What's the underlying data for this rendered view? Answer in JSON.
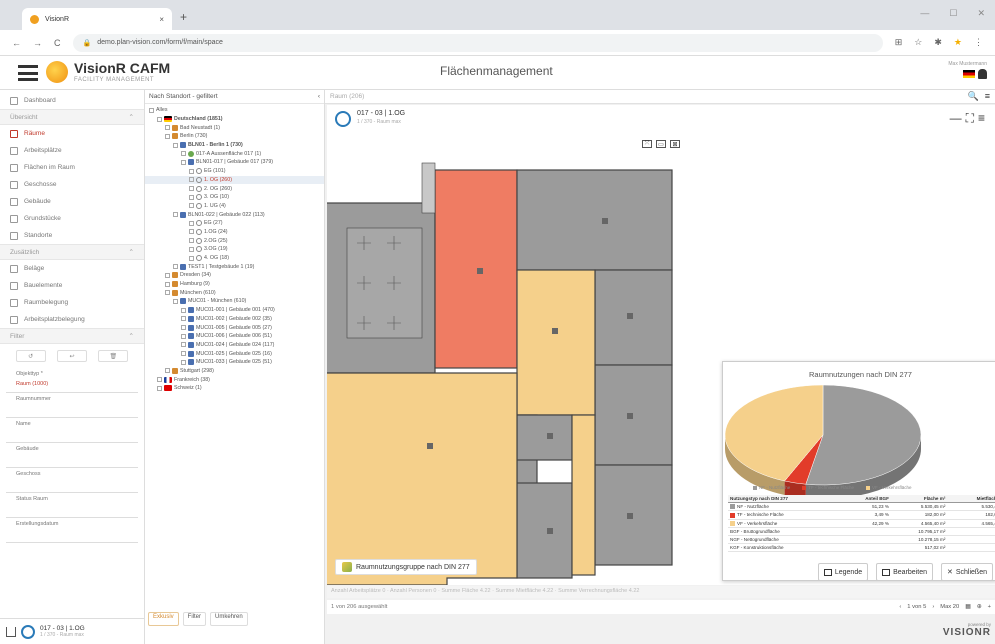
{
  "browser": {
    "tab_title": "VisionR",
    "url": "demo.plan-vision.com/form/f/main/space"
  },
  "header": {
    "brand": "VisionR CAFM",
    "brand_sub": "FACILITY MANAGEMENT",
    "page_title": "Flächenmanagement",
    "user_label": "Max Mustermann"
  },
  "sidebar": {
    "dashboard": "Dashboard",
    "section_overview": "Übersicht",
    "overview_items": [
      {
        "label": "Räume",
        "icon": "door-icon",
        "active": true
      },
      {
        "label": "Arbeitsplätze",
        "icon": "desk-icon",
        "active": false
      },
      {
        "label": "Flächen im Raum",
        "icon": "area-icon",
        "active": false
      },
      {
        "label": "Geschosse",
        "icon": "floor-icon",
        "active": false
      },
      {
        "label": "Gebäude",
        "icon": "building-icon",
        "active": false
      },
      {
        "label": "Grundstücke",
        "icon": "plot-icon",
        "active": false
      },
      {
        "label": "Standorte",
        "icon": "location-icon",
        "active": false
      }
    ],
    "section_additional": "Zusätzlich",
    "additional_items": [
      {
        "label": "Beläge",
        "icon": "flooring-icon"
      },
      {
        "label": "Bauelemente",
        "icon": "element-icon"
      },
      {
        "label": "Raumbelegung",
        "icon": "occupancy-icon"
      },
      {
        "label": "Arbeitsplatzbelegung",
        "icon": "workplace-occupancy-icon"
      }
    ],
    "section_filter": "Filter",
    "filter_fields": [
      {
        "label": "Objekttyp *",
        "value": "Raum (1000)"
      },
      {
        "label": "Raumnummer",
        "value": ""
      },
      {
        "label": "Name",
        "value": ""
      },
      {
        "label": "Gebäude",
        "value": ""
      },
      {
        "label": "Geschoss",
        "value": ""
      },
      {
        "label": "Status Raum",
        "value": ""
      },
      {
        "label": "Erstellungsdatum",
        "value": ""
      }
    ],
    "current_floor": "017 - 03 | 1.OG",
    "current_floor_sub": "1 / 370 - Raum max"
  },
  "tree": {
    "header": "Nach Standort - gefiltert",
    "rows": [
      {
        "level": 0,
        "icon": "",
        "label": "Alles",
        "sel": false
      },
      {
        "level": 1,
        "icon": "de",
        "label": "Deutschland (1851)",
        "sel": false,
        "bold": true
      },
      {
        "level": 2,
        "icon": "city",
        "label": "Bad Neustadt (1)",
        "sel": false
      },
      {
        "level": 2,
        "icon": "city",
        "label": "Berlin (730)",
        "sel": false
      },
      {
        "level": 3,
        "icon": "bld",
        "label": "BLN01 - Berlin 1 (730)",
        "sel": false,
        "bold": true
      },
      {
        "level": 4,
        "icon": "pin",
        "label": "017-A Aussenfläche 017 (1)",
        "sel": false
      },
      {
        "level": 4,
        "icon": "bld",
        "label": "BLN01-017 | Gebäude 017 (379)",
        "sel": false
      },
      {
        "level": 5,
        "icon": "flr",
        "label": "EG (101)",
        "sel": false
      },
      {
        "level": 5,
        "icon": "flr",
        "label": "1. OG (260)",
        "sel": true
      },
      {
        "level": 5,
        "icon": "flr",
        "label": "2. OG (260)",
        "sel": false
      },
      {
        "level": 5,
        "icon": "flr",
        "label": "3. OG (10)",
        "sel": false
      },
      {
        "level": 5,
        "icon": "flr",
        "label": "1. UG (4)",
        "sel": false
      },
      {
        "level": 3,
        "icon": "bld",
        "label": "BLN01-022 | Gebäude 022 (113)",
        "sel": false
      },
      {
        "level": 5,
        "icon": "flr",
        "label": "EG (27)",
        "sel": false
      },
      {
        "level": 5,
        "icon": "flr",
        "label": "1.OG (24)",
        "sel": false
      },
      {
        "level": 5,
        "icon": "flr",
        "label": "2.OG (25)",
        "sel": false
      },
      {
        "level": 5,
        "icon": "flr",
        "label": "3.OG (19)",
        "sel": false
      },
      {
        "level": 5,
        "icon": "flr",
        "label": "4. OG (18)",
        "sel": false
      },
      {
        "level": 3,
        "icon": "bld",
        "label": "TEST1 | Testgebäude 1 (19)",
        "sel": false
      },
      {
        "level": 2,
        "icon": "city",
        "label": "Dresden (34)",
        "sel": false
      },
      {
        "level": 2,
        "icon": "city",
        "label": "Hamburg (9)",
        "sel": false
      },
      {
        "level": 2,
        "icon": "city",
        "label": "München (610)",
        "sel": false
      },
      {
        "level": 3,
        "icon": "bld",
        "label": "MUC01 - München (610)",
        "sel": false
      },
      {
        "level": 4,
        "icon": "bld",
        "label": "MUC01-001 | Gebäude 001 (470)",
        "sel": false
      },
      {
        "level": 4,
        "icon": "bld",
        "label": "MUC01-002 | Gebäude 002 (35)",
        "sel": false
      },
      {
        "level": 4,
        "icon": "bld",
        "label": "MUC01-005 | Gebäude 005 (27)",
        "sel": false
      },
      {
        "level": 4,
        "icon": "bld",
        "label": "MUC01-006 | Gebäude 006 (51)",
        "sel": false
      },
      {
        "level": 4,
        "icon": "bld",
        "label": "MUC01-024 | Gebäude 024 (117)",
        "sel": false
      },
      {
        "level": 4,
        "icon": "bld",
        "label": "MUC01-025 | Gebäude 025 (16)",
        "sel": false
      },
      {
        "level": 4,
        "icon": "bld",
        "label": "MUC01-033 | Gebäude 025 (51)",
        "sel": false
      },
      {
        "level": 2,
        "icon": "city",
        "label": "Stuttgart (298)",
        "sel": false
      },
      {
        "level": 1,
        "icon": "fr",
        "label": "Frankreich (38)",
        "sel": false
      },
      {
        "level": 1,
        "icon": "ch",
        "label": "Schweiz (1)",
        "sel": false
      }
    ],
    "foot_buttons": [
      "Exkusiv",
      "Filter",
      "Umkehren"
    ]
  },
  "main": {
    "search_label": "Raum (206)",
    "floor_title": "017 - 03 | 1.OG",
    "floor_sub": "1 / 370 - Raum max",
    "legend_chip": "Raumnutzungsgruppe nach DIN 277",
    "buttons": [
      "Legende",
      "Bearbeiten",
      "Schließen"
    ],
    "status_text": "Anzahl Arbeitsplätze 0 · Anzahl Personen 0 · Summe Fläche 4.22 · Summe Mietfläche 4.22 · Summe Verrechnungsfläche 4.22",
    "pager_left": "1 von 206 ausgewählt",
    "pager_right": "1 von 5",
    "pager_perpage": "Max 20",
    "footer_powered": "powered by",
    "footer_logo": "VISIONR"
  },
  "chart_data": {
    "type": "pie",
    "title": "Raumnutzungen nach DIN 277",
    "series": [
      {
        "name": "NF - Nutzfläche",
        "value": 51.23,
        "color": "#9b9b9b"
      },
      {
        "name": "TF - technische Fläche",
        "value": 3.49,
        "color": "#e23c2a"
      },
      {
        "name": "VF - Verkehrsfläche",
        "value": 42.29,
        "color": "#f5d08b"
      }
    ],
    "legend_labels": [
      "NF - Nutzfläche",
      "TF - technische Fläche",
      "VF - Verkehrsfläche"
    ],
    "table": {
      "headers": [
        "Nutzungstyp nach DIN 277",
        "Anteil BGF",
        "Fläche m²",
        "Mietfläche m²"
      ],
      "rows": [
        {
          "swatch": "#9b9b9b",
          "cells": [
            "NF - Nutzfläche",
            "51,23 %",
            "5.530,45 m²",
            "5.530,45 m²"
          ]
        },
        {
          "swatch": "#e23c2a",
          "cells": [
            "TF - technische Fläche",
            "3,49 %",
            "182,00 m²",
            "182,00 m²"
          ]
        },
        {
          "swatch": "#f5d08b",
          "cells": [
            "VF - Verkehrsfläche",
            "42,29 %",
            "4.565,40 m²",
            "4.565,40 m²"
          ]
        },
        {
          "swatch": "",
          "cells": [
            "BGF - Bruttogrundfläche",
            "",
            "10.795,17 m²",
            ""
          ]
        },
        {
          "swatch": "",
          "cells": [
            "NGF - Nettogrundfläche",
            "",
            "10.278,15 m²",
            ""
          ]
        },
        {
          "swatch": "",
          "cells": [
            "KGF - Konstruktionsfläche",
            "",
            "517,02 m²",
            ""
          ]
        }
      ]
    }
  },
  "colors": {
    "accent": "#c0392b",
    "room_grey": "#9b9b9b",
    "room_yellow": "#f5d08b",
    "room_red": "#ef7c63",
    "brand_blue": "#2a7ab8"
  }
}
